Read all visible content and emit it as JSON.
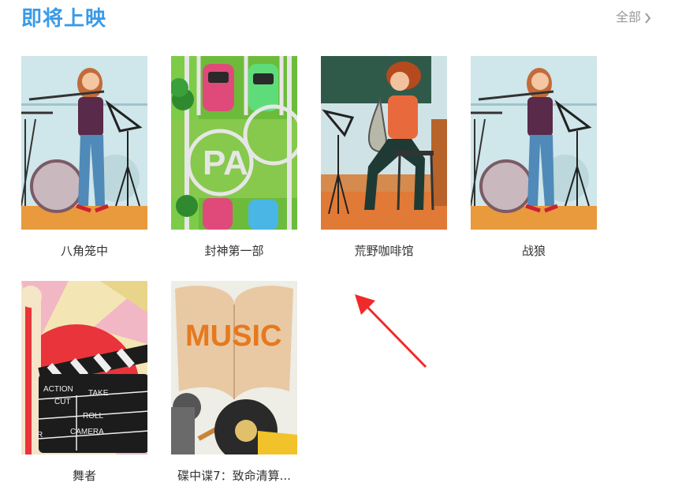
{
  "section": {
    "title": "即将上映",
    "all_label": "全部"
  },
  "movies": [
    {
      "title": "八角笼中",
      "poster": "flute-player"
    },
    {
      "title": "封神第一部",
      "poster": "parking-lot"
    },
    {
      "title": "荒野咖啡馆",
      "poster": "saxophone-player"
    },
    {
      "title": "战狼",
      "poster": "flute-player"
    },
    {
      "title": "舞者",
      "poster": "popcorn-clapperboard"
    },
    {
      "title": "碟中谍7：致命清算...",
      "poster": "music-vinyl"
    }
  ],
  "posters": {
    "parking": {
      "letters": "PA"
    },
    "clapper": {
      "lines": [
        "ACTION",
        "CUT",
        "TAKE",
        "ROLL",
        "R",
        "CAMERA"
      ]
    },
    "music": {
      "word": "MUSIC"
    }
  },
  "colors": {
    "accent": "#3a9ae8",
    "annotation_arrow": "#f02a2a"
  }
}
